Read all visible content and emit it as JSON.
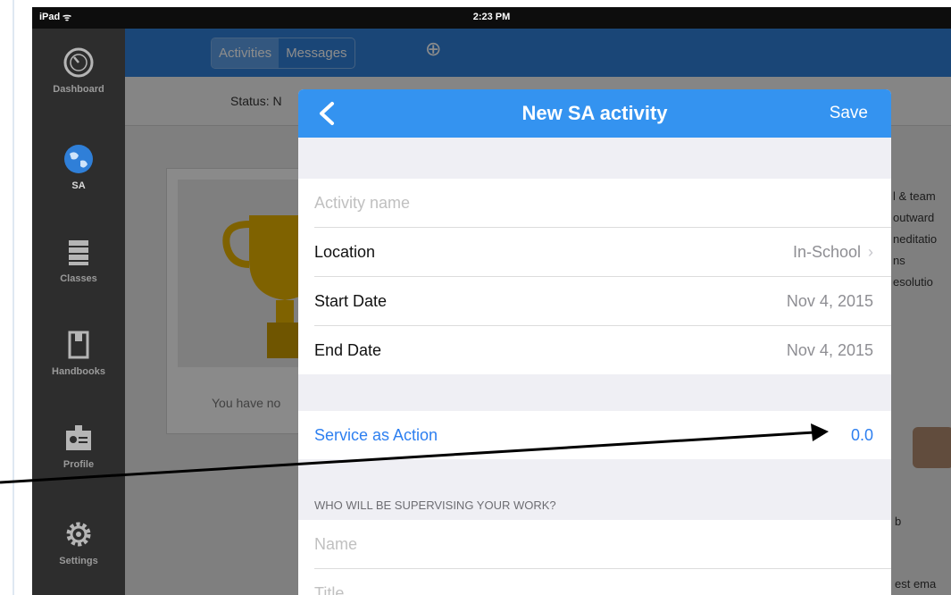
{
  "status_bar": {
    "device": "iPad",
    "time": "2:23 PM"
  },
  "sidebar": {
    "items": [
      {
        "label": "Dashboard",
        "icon": "gauge-icon"
      },
      {
        "label": "SA",
        "icon": "globe-icon",
        "active": true
      },
      {
        "label": "Classes",
        "icon": "books-icon"
      },
      {
        "label": "Handbooks",
        "icon": "handbook-icon"
      },
      {
        "label": "Profile",
        "icon": "id-badge-icon"
      },
      {
        "label": "Settings",
        "icon": "gear-icon"
      }
    ]
  },
  "background": {
    "tabs": [
      "Activities",
      "Messages"
    ],
    "status_label": "Status:",
    "status_partial": "N",
    "empty_message": "You have no",
    "right_lines": [
      "l & team",
      "outward",
      "neditatio",
      "ns",
      "esolutio"
    ],
    "bottom_fragments": [
      "b",
      "est ema"
    ]
  },
  "modal": {
    "title": "New SA activity",
    "save_label": "Save",
    "back_icon": "chevron-left-icon",
    "activity_name_placeholder": "Activity name",
    "location_label": "Location",
    "location_value": "In-School",
    "start_date_label": "Start Date",
    "start_date_value": "Nov 4, 2015",
    "end_date_label": "End Date",
    "end_date_value": "Nov 4, 2015",
    "service_label": "Service as Action",
    "service_value": "0.0",
    "supervisor_header": "WHO WILL BE SUPERVISING YOUR WORK?",
    "name_placeholder": "Name",
    "title_placeholder": "Title"
  },
  "colors": {
    "nav_blue": "#3493f0",
    "link_blue": "#2d7ff0",
    "sidebar_dark": "#2d2d2d"
  }
}
